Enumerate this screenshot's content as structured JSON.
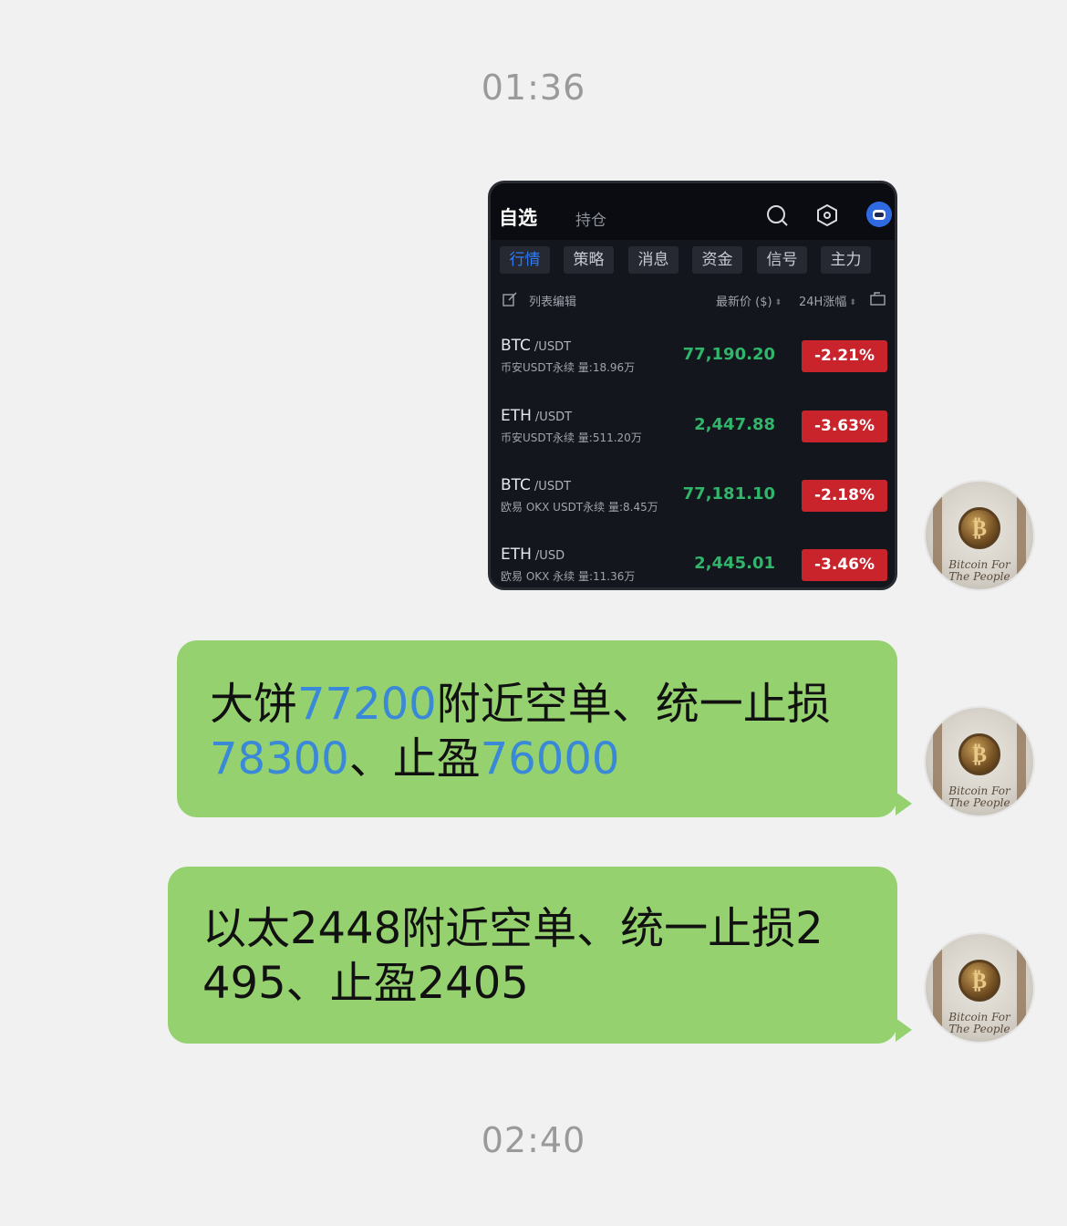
{
  "timestamps": [
    "01:36",
    "02:40"
  ],
  "screenshot": {
    "tabs": {
      "selected": "自选",
      "other": "持仓"
    },
    "icons": [
      "search-icon",
      "hexagon-settings-icon",
      "robot-icon"
    ],
    "categories": [
      "行情",
      "策略",
      "消息",
      "资金",
      "信号",
      "主力"
    ],
    "active_category": "行情",
    "list_header": {
      "edit_label": "列表编辑",
      "price_label": "最新价 ($)",
      "change_label": "24H涨幅"
    },
    "rows": [
      {
        "base": "BTC",
        "quote": "/USDT",
        "sub": "币安USDT永续 量:18.96万",
        "price": "77,190.20",
        "change": "-2.21%"
      },
      {
        "base": "ETH",
        "quote": "/USDT",
        "sub": "币安USDT永续 量:511.20万",
        "price": "2,447.88",
        "change": "-3.63%"
      },
      {
        "base": "BTC",
        "quote": "/USDT",
        "sub": "欧易 OKX USDT永续 量:8.45万",
        "price": "77,181.10",
        "change": "-2.18%"
      },
      {
        "base": "ETH",
        "quote": "/USD",
        "sub": "欧易 OKX 永续 量:11.36万",
        "price": "2,445.01",
        "change": "-3.46%"
      }
    ],
    "colors": {
      "up_price": "#2fb66a",
      "down_badge": "#c9232c",
      "active_tab": "#2f7bf6"
    }
  },
  "avatar": {
    "caption_line1": "Bitcoin For",
    "caption_line2": "The People",
    "coin_glyph": "₿"
  },
  "messages": [
    {
      "line1": {
        "a": "大饼",
        "n1": "77200",
        "b": "附近空单、统一止损"
      },
      "line2": {
        "n2": "78300",
        "c": "、止盈",
        "n3": "76000"
      }
    },
    {
      "line1": "以太2448附近空单、统一止损2",
      "line2": "495、止盈2405"
    }
  ],
  "bubble_color": "#95d26f"
}
